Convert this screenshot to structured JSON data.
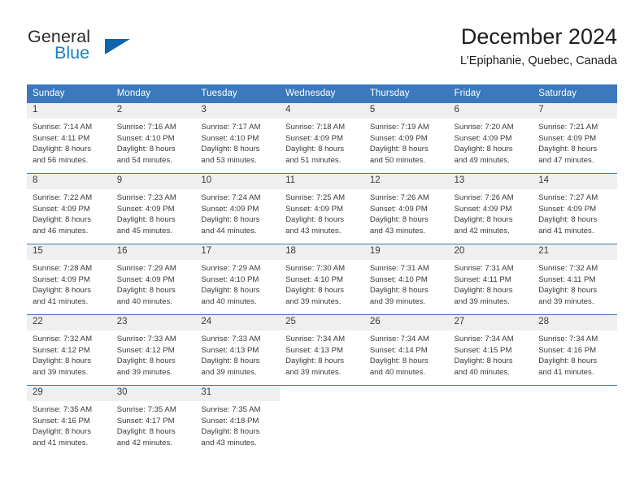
{
  "brand": {
    "word_one": "General",
    "word_two": "Blue",
    "logo_icon": "triangle-logo-icon",
    "accent_color": "#1064ac",
    "blue_text_color": "#1a7fc1"
  },
  "header": {
    "title": "December 2024",
    "location": "L'Epiphanie, Quebec, Canada"
  },
  "theme": {
    "header_row_color": "#3b78bd",
    "day_band_color": "#efefef",
    "text_color": "#3a3a3a"
  },
  "calendar": {
    "weekday_headers": [
      "Sunday",
      "Monday",
      "Tuesday",
      "Wednesday",
      "Thursday",
      "Friday",
      "Saturday"
    ],
    "labels": {
      "sunrise": "Sunrise:",
      "sunset": "Sunset:",
      "daylight": "Daylight:"
    },
    "weeks": [
      [
        {
          "day": "1",
          "sunrise": "Sunrise: 7:14 AM",
          "sunset": "Sunset: 4:11 PM",
          "daylight_line1": "Daylight: 8 hours",
          "daylight_line2": "and 56 minutes."
        },
        {
          "day": "2",
          "sunrise": "Sunrise: 7:16 AM",
          "sunset": "Sunset: 4:10 PM",
          "daylight_line1": "Daylight: 8 hours",
          "daylight_line2": "and 54 minutes."
        },
        {
          "day": "3",
          "sunrise": "Sunrise: 7:17 AM",
          "sunset": "Sunset: 4:10 PM",
          "daylight_line1": "Daylight: 8 hours",
          "daylight_line2": "and 53 minutes."
        },
        {
          "day": "4",
          "sunrise": "Sunrise: 7:18 AM",
          "sunset": "Sunset: 4:09 PM",
          "daylight_line1": "Daylight: 8 hours",
          "daylight_line2": "and 51 minutes."
        },
        {
          "day": "5",
          "sunrise": "Sunrise: 7:19 AM",
          "sunset": "Sunset: 4:09 PM",
          "daylight_line1": "Daylight: 8 hours",
          "daylight_line2": "and 50 minutes."
        },
        {
          "day": "6",
          "sunrise": "Sunrise: 7:20 AM",
          "sunset": "Sunset: 4:09 PM",
          "daylight_line1": "Daylight: 8 hours",
          "daylight_line2": "and 49 minutes."
        },
        {
          "day": "7",
          "sunrise": "Sunrise: 7:21 AM",
          "sunset": "Sunset: 4:09 PM",
          "daylight_line1": "Daylight: 8 hours",
          "daylight_line2": "and 47 minutes."
        }
      ],
      [
        {
          "day": "8",
          "sunrise": "Sunrise: 7:22 AM",
          "sunset": "Sunset: 4:09 PM",
          "daylight_line1": "Daylight: 8 hours",
          "daylight_line2": "and 46 minutes."
        },
        {
          "day": "9",
          "sunrise": "Sunrise: 7:23 AM",
          "sunset": "Sunset: 4:09 PM",
          "daylight_line1": "Daylight: 8 hours",
          "daylight_line2": "and 45 minutes."
        },
        {
          "day": "10",
          "sunrise": "Sunrise: 7:24 AM",
          "sunset": "Sunset: 4:09 PM",
          "daylight_line1": "Daylight: 8 hours",
          "daylight_line2": "and 44 minutes."
        },
        {
          "day": "11",
          "sunrise": "Sunrise: 7:25 AM",
          "sunset": "Sunset: 4:09 PM",
          "daylight_line1": "Daylight: 8 hours",
          "daylight_line2": "and 43 minutes."
        },
        {
          "day": "12",
          "sunrise": "Sunrise: 7:26 AM",
          "sunset": "Sunset: 4:09 PM",
          "daylight_line1": "Daylight: 8 hours",
          "daylight_line2": "and 43 minutes."
        },
        {
          "day": "13",
          "sunrise": "Sunrise: 7:26 AM",
          "sunset": "Sunset: 4:09 PM",
          "daylight_line1": "Daylight: 8 hours",
          "daylight_line2": "and 42 minutes."
        },
        {
          "day": "14",
          "sunrise": "Sunrise: 7:27 AM",
          "sunset": "Sunset: 4:09 PM",
          "daylight_line1": "Daylight: 8 hours",
          "daylight_line2": "and 41 minutes."
        }
      ],
      [
        {
          "day": "15",
          "sunrise": "Sunrise: 7:28 AM",
          "sunset": "Sunset: 4:09 PM",
          "daylight_line1": "Daylight: 8 hours",
          "daylight_line2": "and 41 minutes."
        },
        {
          "day": "16",
          "sunrise": "Sunrise: 7:29 AM",
          "sunset": "Sunset: 4:09 PM",
          "daylight_line1": "Daylight: 8 hours",
          "daylight_line2": "and 40 minutes."
        },
        {
          "day": "17",
          "sunrise": "Sunrise: 7:29 AM",
          "sunset": "Sunset: 4:10 PM",
          "daylight_line1": "Daylight: 8 hours",
          "daylight_line2": "and 40 minutes."
        },
        {
          "day": "18",
          "sunrise": "Sunrise: 7:30 AM",
          "sunset": "Sunset: 4:10 PM",
          "daylight_line1": "Daylight: 8 hours",
          "daylight_line2": "and 39 minutes."
        },
        {
          "day": "19",
          "sunrise": "Sunrise: 7:31 AM",
          "sunset": "Sunset: 4:10 PM",
          "daylight_line1": "Daylight: 8 hours",
          "daylight_line2": "and 39 minutes."
        },
        {
          "day": "20",
          "sunrise": "Sunrise: 7:31 AM",
          "sunset": "Sunset: 4:11 PM",
          "daylight_line1": "Daylight: 8 hours",
          "daylight_line2": "and 39 minutes."
        },
        {
          "day": "21",
          "sunrise": "Sunrise: 7:32 AM",
          "sunset": "Sunset: 4:11 PM",
          "daylight_line1": "Daylight: 8 hours",
          "daylight_line2": "and 39 minutes."
        }
      ],
      [
        {
          "day": "22",
          "sunrise": "Sunrise: 7:32 AM",
          "sunset": "Sunset: 4:12 PM",
          "daylight_line1": "Daylight: 8 hours",
          "daylight_line2": "and 39 minutes."
        },
        {
          "day": "23",
          "sunrise": "Sunrise: 7:33 AM",
          "sunset": "Sunset: 4:12 PM",
          "daylight_line1": "Daylight: 8 hours",
          "daylight_line2": "and 39 minutes."
        },
        {
          "day": "24",
          "sunrise": "Sunrise: 7:33 AM",
          "sunset": "Sunset: 4:13 PM",
          "daylight_line1": "Daylight: 8 hours",
          "daylight_line2": "and 39 minutes."
        },
        {
          "day": "25",
          "sunrise": "Sunrise: 7:34 AM",
          "sunset": "Sunset: 4:13 PM",
          "daylight_line1": "Daylight: 8 hours",
          "daylight_line2": "and 39 minutes."
        },
        {
          "day": "26",
          "sunrise": "Sunrise: 7:34 AM",
          "sunset": "Sunset: 4:14 PM",
          "daylight_line1": "Daylight: 8 hours",
          "daylight_line2": "and 40 minutes."
        },
        {
          "day": "27",
          "sunrise": "Sunrise: 7:34 AM",
          "sunset": "Sunset: 4:15 PM",
          "daylight_line1": "Daylight: 8 hours",
          "daylight_line2": "and 40 minutes."
        },
        {
          "day": "28",
          "sunrise": "Sunrise: 7:34 AM",
          "sunset": "Sunset: 4:16 PM",
          "daylight_line1": "Daylight: 8 hours",
          "daylight_line2": "and 41 minutes."
        }
      ],
      [
        {
          "day": "29",
          "sunrise": "Sunrise: 7:35 AM",
          "sunset": "Sunset: 4:16 PM",
          "daylight_line1": "Daylight: 8 hours",
          "daylight_line2": "and 41 minutes."
        },
        {
          "day": "30",
          "sunrise": "Sunrise: 7:35 AM",
          "sunset": "Sunset: 4:17 PM",
          "daylight_line1": "Daylight: 8 hours",
          "daylight_line2": "and 42 minutes."
        },
        {
          "day": "31",
          "sunrise": "Sunrise: 7:35 AM",
          "sunset": "Sunset: 4:18 PM",
          "daylight_line1": "Daylight: 8 hours",
          "daylight_line2": "and 43 minutes."
        },
        {
          "day": "",
          "sunrise": "",
          "sunset": "",
          "daylight_line1": "",
          "daylight_line2": ""
        },
        {
          "day": "",
          "sunrise": "",
          "sunset": "",
          "daylight_line1": "",
          "daylight_line2": ""
        },
        {
          "day": "",
          "sunrise": "",
          "sunset": "",
          "daylight_line1": "",
          "daylight_line2": ""
        },
        {
          "day": "",
          "sunrise": "",
          "sunset": "",
          "daylight_line1": "",
          "daylight_line2": ""
        }
      ]
    ]
  }
}
